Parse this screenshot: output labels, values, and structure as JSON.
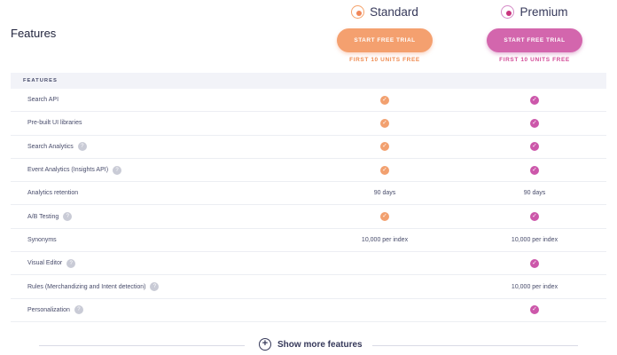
{
  "page": {
    "heading": "Features"
  },
  "plans": [
    {
      "name": "Standard",
      "icon": "standard-plan-icon",
      "cta": "START FREE TRIAL",
      "note": "FIRST 10 UNITS FREE",
      "color": "#f4a06f"
    },
    {
      "name": "Premium",
      "icon": "premium-plan-icon",
      "cta": "START FREE TRIAL",
      "note": "FIRST 10 UNITS FREE",
      "color": "#d366ad"
    }
  ],
  "section": {
    "label": "FEATURES"
  },
  "rows": [
    {
      "label": "Search API",
      "info": false,
      "standard": "check",
      "premium": "check"
    },
    {
      "label": "Pre-built UI libraries",
      "info": false,
      "standard": "check",
      "premium": "check"
    },
    {
      "label": "Search Analytics",
      "info": true,
      "standard": "check",
      "premium": "check"
    },
    {
      "label": "Event Analytics (Insights API)",
      "info": true,
      "standard": "check",
      "premium": "check"
    },
    {
      "label": "Analytics retention",
      "info": false,
      "standard": "90 days",
      "premium": "90 days"
    },
    {
      "label": "A/B Testing",
      "info": true,
      "standard": "check",
      "premium": "check"
    },
    {
      "label": "Synonyms",
      "info": false,
      "standard": "10,000 per index",
      "premium": "10,000 per index"
    },
    {
      "label": "Visual Editor",
      "info": true,
      "standard": "",
      "premium": "check"
    },
    {
      "label": "Rules (Merchandizing and Intent detection)",
      "info": true,
      "standard": "",
      "premium": "10,000 per index"
    },
    {
      "label": "Personalization",
      "info": true,
      "standard": "",
      "premium": "check"
    }
  ],
  "footer": {
    "show_more_label": "Show more features"
  }
}
